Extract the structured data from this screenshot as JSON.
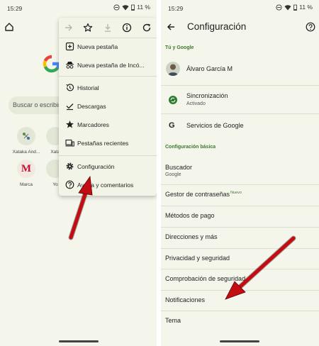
{
  "colors": {
    "screen_bg": "#f4f6ec",
    "menu_bg": "#f2f4e8",
    "accent_green": "#3b7a2a",
    "arrow_red": "#c40d12"
  },
  "left_phone": {
    "status": {
      "time": "15:29",
      "battery": "11 %"
    },
    "search_placeholder": "Buscar o escribir",
    "shortcuts": [
      {
        "label": "Xataka And...",
        "icon": "xataka-icon"
      },
      {
        "label": "Xata",
        "icon": ""
      },
      {
        "label": "Marca",
        "icon": "marca-icon",
        "glyph": "M"
      },
      {
        "label": "Yo",
        "icon": ""
      }
    ],
    "menu": {
      "toolbar": [
        "forward-icon",
        "star-icon",
        "download-icon",
        "info-icon",
        "refresh-icon"
      ],
      "items": [
        {
          "label": "Nueva pestaña",
          "icon": "new-tab-icon"
        },
        {
          "label": "Nueva pestaña de Incó...",
          "icon": "incognito-icon"
        },
        {
          "label": "Historial",
          "icon": "history-icon"
        },
        {
          "label": "Descargas",
          "icon": "downloads-icon"
        },
        {
          "label": "Marcadores",
          "icon": "bookmarks-icon"
        },
        {
          "label": "Pestañas recientes",
          "icon": "recent-tabs-icon"
        },
        {
          "label": "Configuración",
          "icon": "settings-gear-icon"
        },
        {
          "label": "Ayuda y comentarios",
          "icon": "help-icon"
        }
      ]
    }
  },
  "right_phone": {
    "status": {
      "time": "15:29",
      "battery": "11 %"
    },
    "title": "Configuración",
    "section_you": "Tú y Google",
    "account_name": "Álvaro García M",
    "sync": {
      "title": "Sincronización",
      "subtitle": "Activado"
    },
    "google_services": "Servicios de Google",
    "section_basic": "Configuración básica",
    "search_engine": {
      "title": "Buscador",
      "subtitle": "Google"
    },
    "password_manager": {
      "title": "Gestor de contraseñas",
      "badge": "Nuevo"
    },
    "rows": [
      "Métodos de pago",
      "Direcciones y más",
      "Privacidad y seguridad",
      "Comprobación de seguridad",
      "Notificaciones",
      "Tema"
    ]
  }
}
